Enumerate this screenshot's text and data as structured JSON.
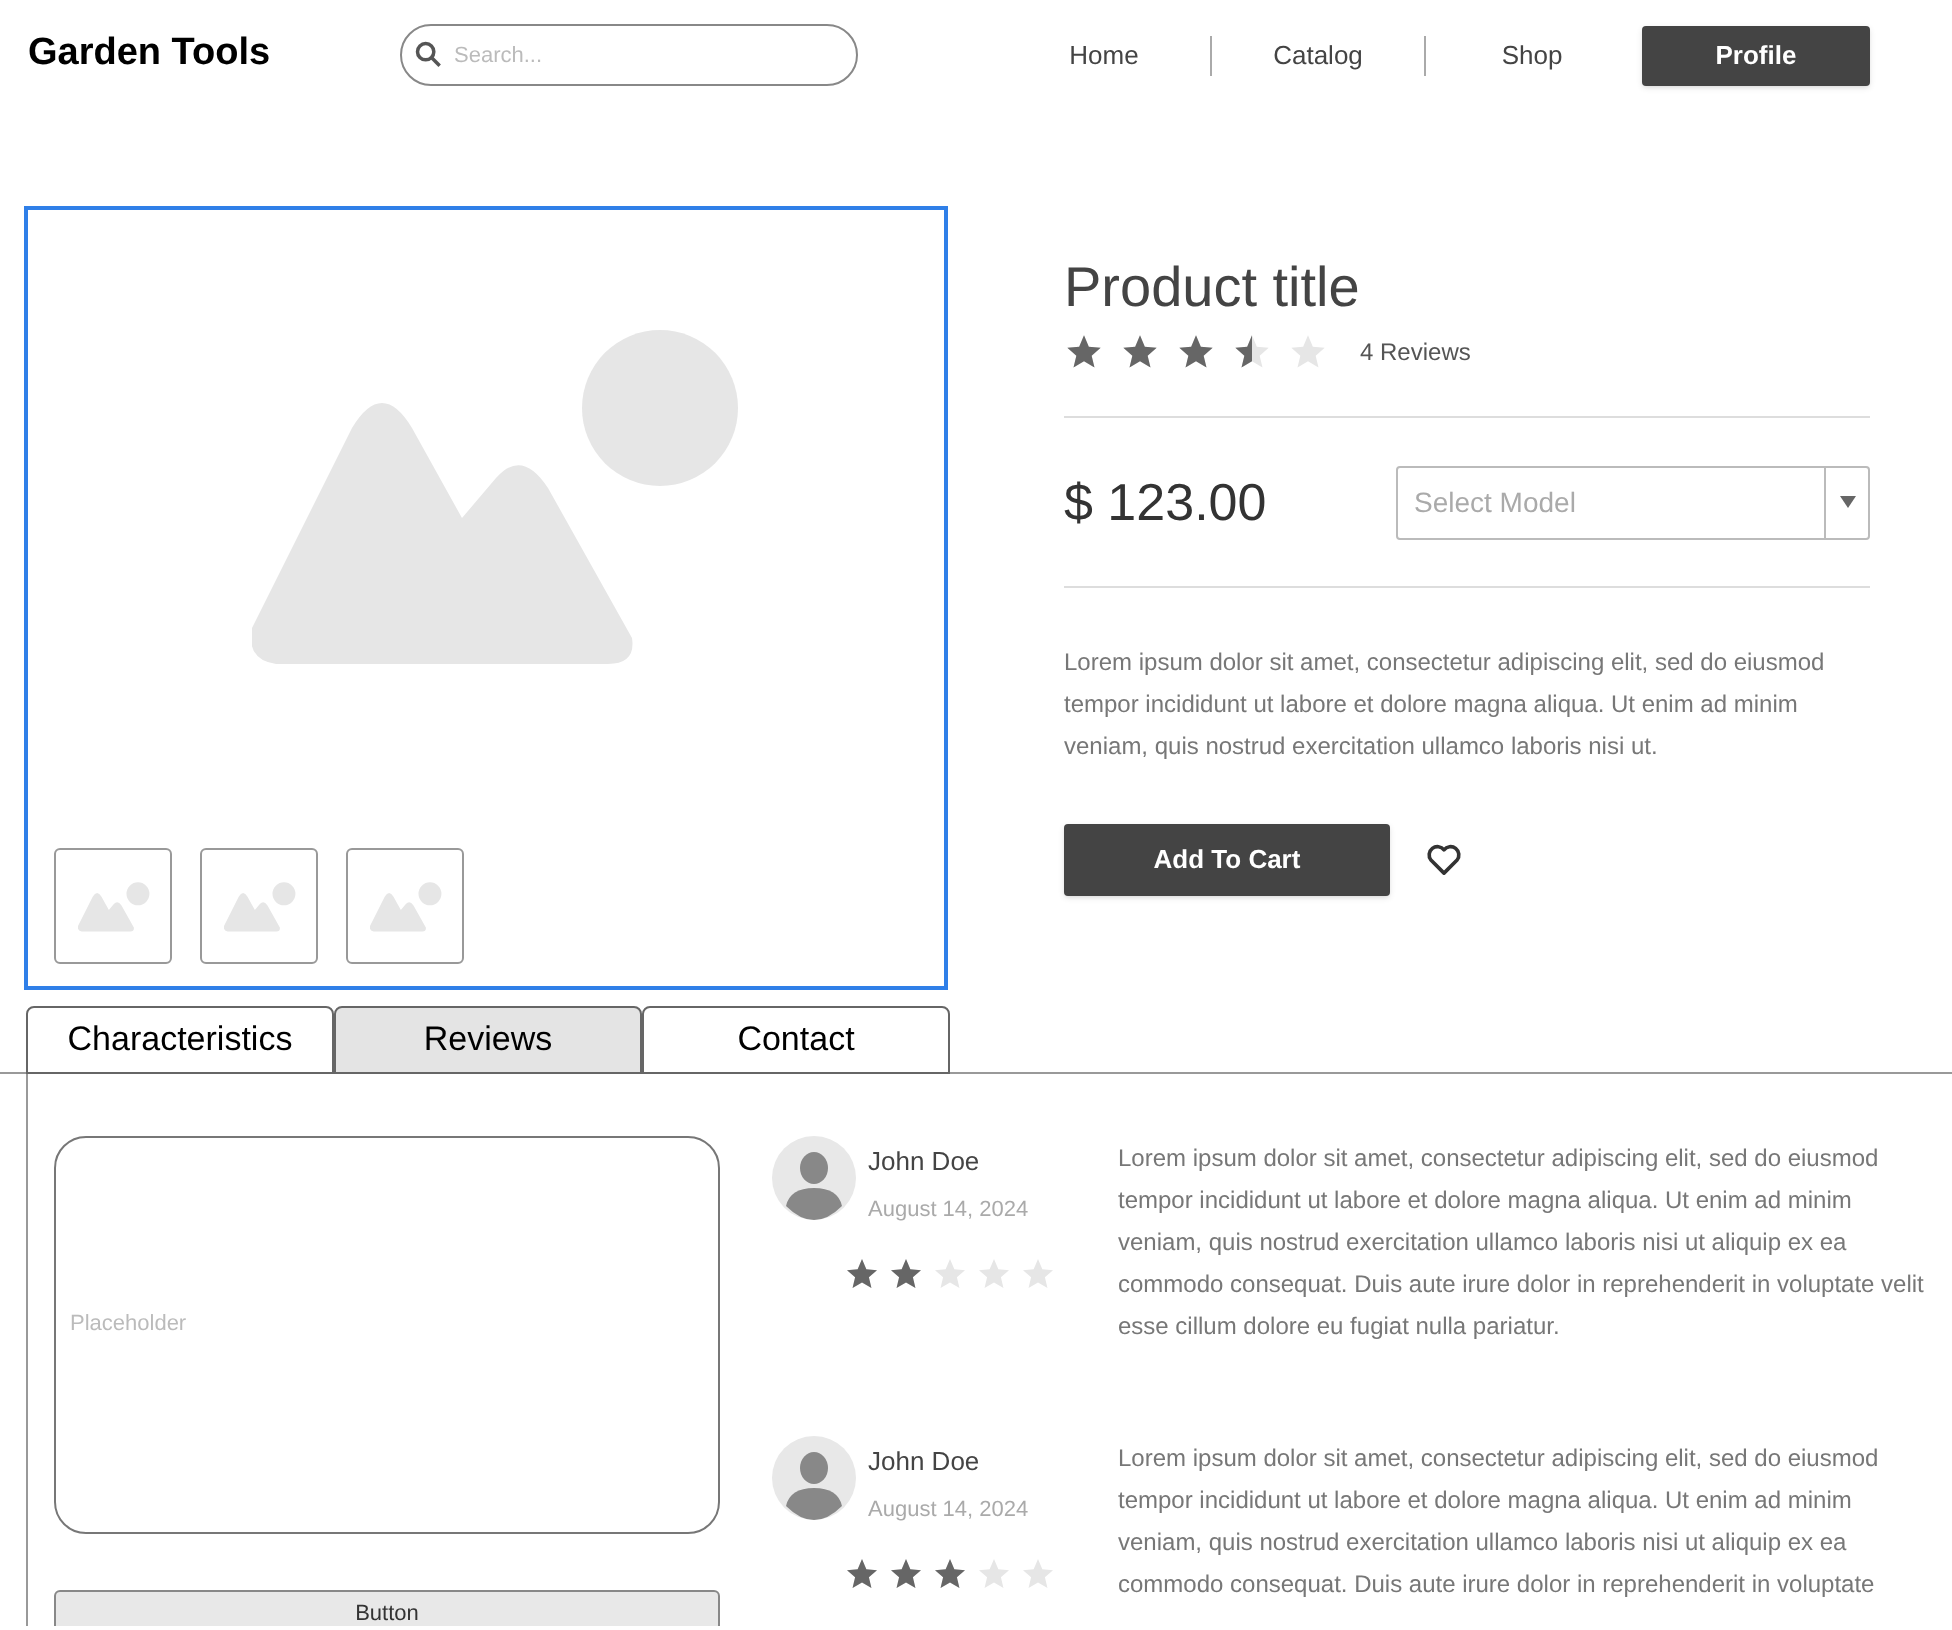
{
  "header": {
    "logo": "Garden Tools",
    "search": {
      "placeholder": "Search..."
    },
    "nav": [
      {
        "label": "Home"
      },
      {
        "label": "Catalog"
      },
      {
        "label": "Shop"
      }
    ],
    "profile_button": "Profile"
  },
  "product": {
    "title": "Product title",
    "stars": 3.5,
    "reviews_count": "4 Reviews",
    "price": "$ 123.00",
    "model_select": {
      "placeholder": "Select Model"
    },
    "description": "Lorem ipsum dolor sit amet, consectetur adipiscing elit, sed do eiusmod tempor incididunt ut labore et dolore magna aliqua. Ut enim ad minim veniam, quis nostrud exercitation ullamco laboris nisi ut.",
    "add_to_cart": "Add To Cart"
  },
  "tabs": [
    {
      "label": "Characteristics",
      "selected": false
    },
    {
      "label": "Reviews",
      "selected": true
    },
    {
      "label": "Contact",
      "selected": false
    }
  ],
  "review_form": {
    "placeholder": "Placeholder",
    "button": "Button"
  },
  "reviews": [
    {
      "name": "John Doe",
      "date": "August 14, 2024",
      "stars": 2,
      "text": "Lorem ipsum dolor sit amet, consectetur adipiscing elit, sed do eiusmod tempor incididunt ut labore et dolore magna aliqua. Ut enim ad minim veniam, quis nostrud exercitation ullamco laboris nisi ut aliquip ex ea commodo consequat. Duis aute irure dolor in reprehenderit in voluptate velit esse cillum dolore eu fugiat nulla pariatur."
    },
    {
      "name": "John Doe",
      "date": "August 14, 2024",
      "stars": 3,
      "text": "Lorem ipsum dolor sit amet, consectetur adipiscing elit, sed do eiusmod tempor incididunt ut labore et dolore magna aliqua. Ut enim ad minim veniam, quis nostrud exercitation ullamco laboris nisi ut aliquip ex ea commodo consequat. Duis aute irure dolor in reprehenderit in voluptate"
    }
  ]
}
